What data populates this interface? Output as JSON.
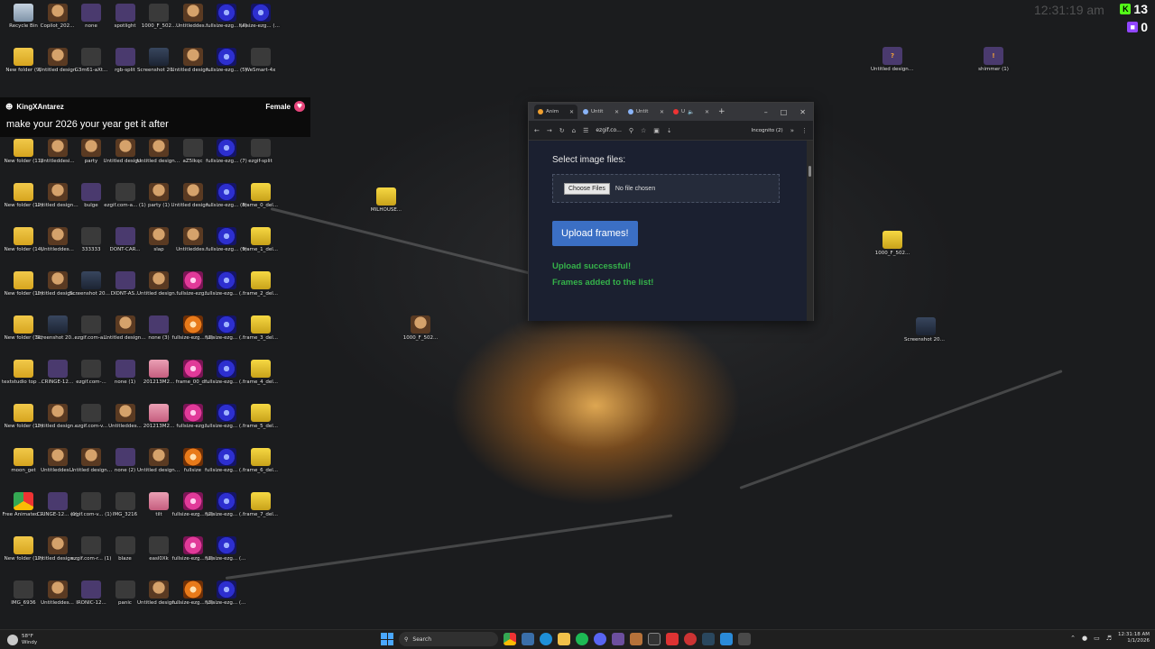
{
  "desktop": {
    "columns": [
      [
        "Recycle Bin",
        "New folder (9)",
        "",
        "New folder (11)",
        "New folder (12)",
        "New folder (14)",
        "New folder (15)",
        "New folder (16)",
        "textstudio top color ...",
        "New folder (13)",
        "moon_get",
        "Free Animated ...",
        "New folder (17)",
        "IMG_6936"
      ],
      [
        "Copilot_202...",
        "Untitled design",
        "",
        "Untitleddesi...",
        "Untitled design (2)",
        "Untitleddes...",
        "Untitled design (1)",
        "Screenshot 2025-12-...",
        "CRINGE-12...",
        "Untitled design (3)",
        "Untitleddes...",
        "CRINGE-12... (1)",
        "Untitled design (4)",
        "Untitleddes..."
      ],
      [
        "none",
        "G3m61-aXt...",
        "",
        "party",
        "bulge",
        "333333",
        "Screenshot 2025-12-...",
        "ezgif.com-a...",
        "ezgif.com-...",
        "ezgif.com-v...",
        "Untitled design (1)",
        "ezgif.com-v... (1)",
        "ezgif.com-r... (1)",
        "IRONIC-12..."
      ],
      [
        "spotlight",
        "rgb-split",
        "",
        "Untitled design (5)",
        "ezgif.com-a... (1)",
        "DONT-CAR...",
        "DIDNT-AS...",
        "Untitled design (6)",
        "none (1)",
        "Untitleddes...",
        "none (2)",
        "IMG_3216",
        "blaze",
        "panic"
      ],
      [
        "1000_F_502...",
        "Screenshot 2025-12-...",
        "",
        "Untitled design (8)",
        "party (1)",
        "slap",
        "Untitled design (9)",
        "none (3)",
        "201213M2...",
        "201213M2...",
        "Untitled design (10)",
        "tilt",
        "easl0Xk",
        "Untitled design (11)"
      ],
      [
        "Untitleddes...",
        "Untitled design (12)",
        "",
        "aZ5Ikqc",
        "Untitled design (13)",
        "Untitleddes...",
        "fullsize-ezg...",
        "fullsize-ezg... (1)",
        "frame_00_d...",
        "fullsize-ezg...",
        "fullsize",
        "fullsize-ezg... (2)",
        "fullsize-ezg... (1)",
        "fullsize-ezg... (3)"
      ],
      [
        "fullsize-ezg... (4)",
        "fullsize-ezg... (5)",
        "",
        "fullsize-ezg... (7)",
        "fullsize-ezg... (8)",
        "fullsize-ezg... (9)",
        "fullsize-ezg... (10)",
        "fullsize-ezg... (11)",
        "fullsize-ezg... (12)",
        "fullsize-ezg... (13)",
        "fullsize-ezg... (14)",
        "fullsize-ezg... (15)",
        "fullsize-ezg... (16)",
        "fullsize-ezg... (17)"
      ],
      [
        "fullsize-ezg... (18)",
        "WeSmart-4x",
        "",
        "ezgif-split",
        "frame_0_del...",
        "frame_1_del...",
        "frame_2_del...",
        "frame_3_del...",
        "frame_4_del...",
        "frame_5_del...",
        "frame_6_del...",
        "frame_7_del...",
        "",
        ""
      ]
    ],
    "loose_icons": {
      "milhouse": "MILHOUSE...",
      "f502_a": "1000_F_502...",
      "f502_b": "1000_F_502...",
      "didnt_ask": "Untitled design (7)",
      "shimmer": "shimmer (1)",
      "screenshot": "Screenshot 2025-12-..."
    }
  },
  "chat": {
    "username": "KingXAntarez",
    "gender": "Female",
    "message": "make your 2026 your year get it after"
  },
  "overlay": {
    "clock": "12:31:19 am",
    "kick_count": "13",
    "twitch_count": "0"
  },
  "browser": {
    "tabs": [
      {
        "label": "Anim"
      },
      {
        "label": "Untit"
      },
      {
        "label": "Untit"
      },
      {
        "label": "U"
      }
    ],
    "url": "ezgif.co...",
    "incognito": "Incognito (2)",
    "select_label": "Select image files:",
    "choose_files": "Choose Files",
    "no_file": "No file chosen",
    "upload_button": "Upload frames!",
    "success_line1": "Upload successful!",
    "success_line2": "Frames added to the list!"
  },
  "taskbar": {
    "weather_temp": "58°F",
    "weather_cond": "Windy",
    "search_placeholder": "Search",
    "time": "12:31:18 AM",
    "date": "1/1/2026"
  }
}
